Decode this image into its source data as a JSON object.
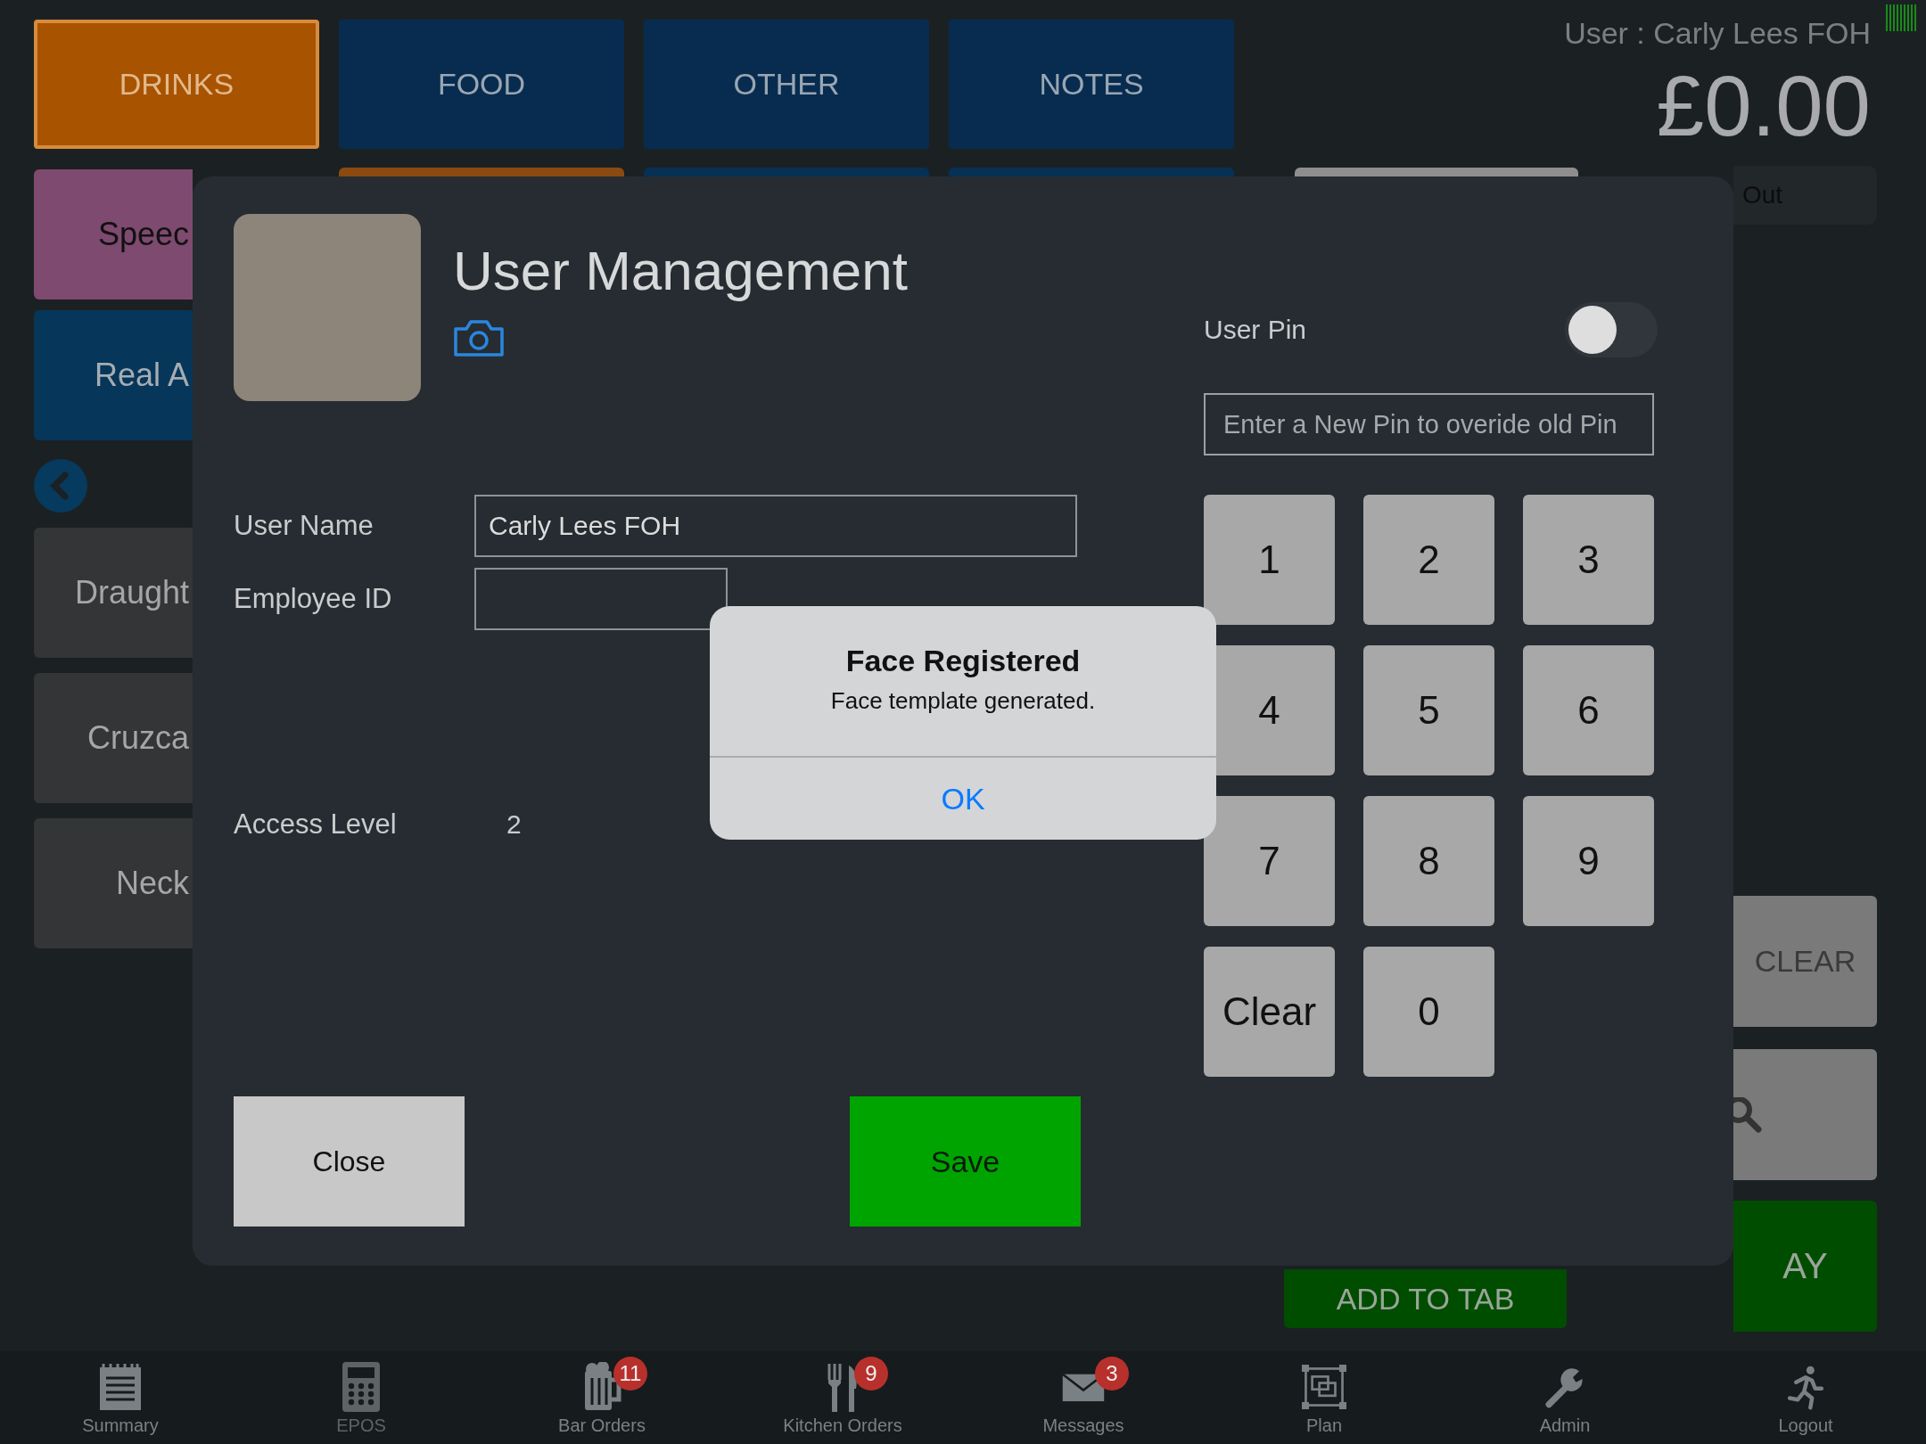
{
  "category_tabs": [
    {
      "label": "DRINKS",
      "selected": true
    },
    {
      "label": "FOOD",
      "selected": false
    },
    {
      "label": "OTHER",
      "selected": false
    },
    {
      "label": "NOTES",
      "selected": false
    }
  ],
  "header": {
    "user": "User : Carly Lees FOH",
    "total": "£0.00"
  },
  "quick_buttons": [
    {
      "label": "Speec",
      "color": "#7e4a70"
    },
    {
      "label": "Real A",
      "color": "#06365a"
    }
  ],
  "product_buttons": [
    {
      "label": "Draught"
    },
    {
      "label": "Cruzca"
    },
    {
      "label": "Neck"
    }
  ],
  "order_panel": {
    "out_label": "Out",
    "clear_button": "CLEAR",
    "add_to_tab_button": "ADD TO TAB",
    "pay_button": "AY"
  },
  "user_management": {
    "title": "User Management",
    "fields": [
      {
        "label": "User Name",
        "value": "Carly Lees FOH"
      },
      {
        "label": "Employee ID"
      }
    ],
    "access_level": {
      "label": "Access Level",
      "value": "2"
    },
    "user_pin": {
      "label": "User Pin",
      "on": false,
      "placeholder": "Enter a New Pin to overide old Pin"
    },
    "keypad": [
      "1",
      "2",
      "3",
      "4",
      "5",
      "6",
      "7",
      "8",
      "9",
      "Clear",
      "0"
    ],
    "close_button": "Close",
    "save_button": "Save"
  },
  "alert": {
    "title": "Face Registered",
    "message": "Face template generated.",
    "button": "OK"
  },
  "bottom_nav": [
    {
      "label": "Summary",
      "selected": false
    },
    {
      "label": "EPOS",
      "selected": true
    },
    {
      "label": "Bar Orders",
      "badge": "11",
      "selected": false
    },
    {
      "label": "Kitchen Orders",
      "badge": "9",
      "selected": false
    },
    {
      "label": "Messages",
      "badge": "3",
      "selected": false
    },
    {
      "label": "Plan",
      "selected": false
    },
    {
      "label": "Admin",
      "selected": false
    },
    {
      "label": "Logout",
      "selected": false
    }
  ]
}
